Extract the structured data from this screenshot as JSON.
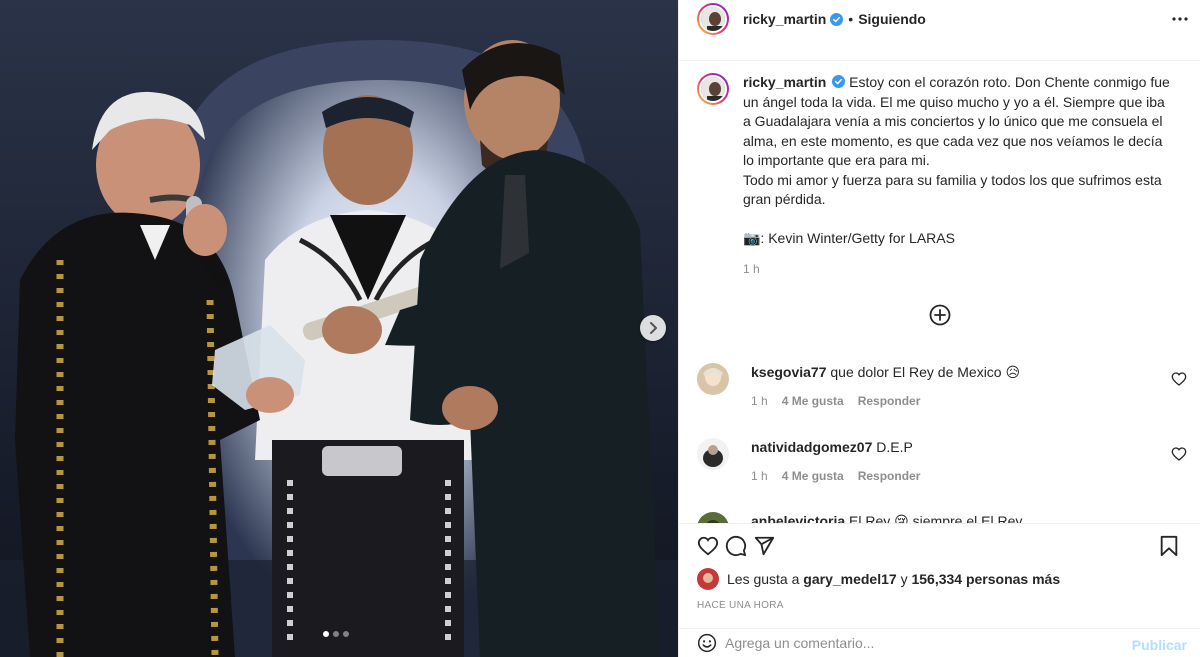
{
  "post": {
    "username": "ricky_martin",
    "dot": "•",
    "follow_state": "Siguiendo",
    "caption": {
      "username": "ricky_martin",
      "lines": [
        "Estoy con el corazón roto. Don Chente conmigo fue",
        "un ángel toda la vida. El me quiso mucho y yo a él. Siempre que iba",
        "a Guadalajara venía a mis conciertos y lo único que me consuela el",
        "alma, en este momento, es que cada vez que nos veíamos le decía",
        "lo importante que era para mi.",
        "Todo mi amor y fuerza para su familia y todos los que sufrimos esta",
        "gran pérdida."
      ],
      "credit": "📷: Kevin Winter/Getty for LARAS",
      "time": "1 h"
    },
    "comments": [
      {
        "username": "ksegovia77",
        "text": "que dolor El Rey de Mexico 😥",
        "time": "1 h",
        "likes": "4 Me gusta",
        "reply": "Responder"
      },
      {
        "username": "natividadgomez07",
        "text": "D.E.P",
        "time": "1 h",
        "likes": "4 Me gusta",
        "reply": "Responder"
      },
      {
        "username": "anbelevictoria",
        "text": "El Rey 😢 siempre el El Rey",
        "time": "",
        "likes": "",
        "reply": ""
      }
    ],
    "likes_line": {
      "prefix": "Les gusta a",
      "user": "gary_medel17",
      "middle": "y",
      "count": "156,334 personas más"
    },
    "posted_ago": "HACE UNA HORA",
    "comment_placeholder": "Agrega un comentario...",
    "publish_label": "Publicar",
    "carousel": {
      "total_slides": 3,
      "active_slide": 1
    }
  },
  "colors": {
    "verified": "#3897f0",
    "meta_text": "#8e8e8e",
    "publish_disabled": "#b2dffc",
    "divider": "#efefef"
  },
  "icons": {
    "header_more": "more-horizontal-icon",
    "load_more": "plus-circle-icon",
    "like": "heart-icon",
    "comment": "comment-icon",
    "share": "share-icon",
    "save": "bookmark-icon",
    "emoji": "smiley-icon",
    "carousel_next": "chevron-right-icon"
  }
}
